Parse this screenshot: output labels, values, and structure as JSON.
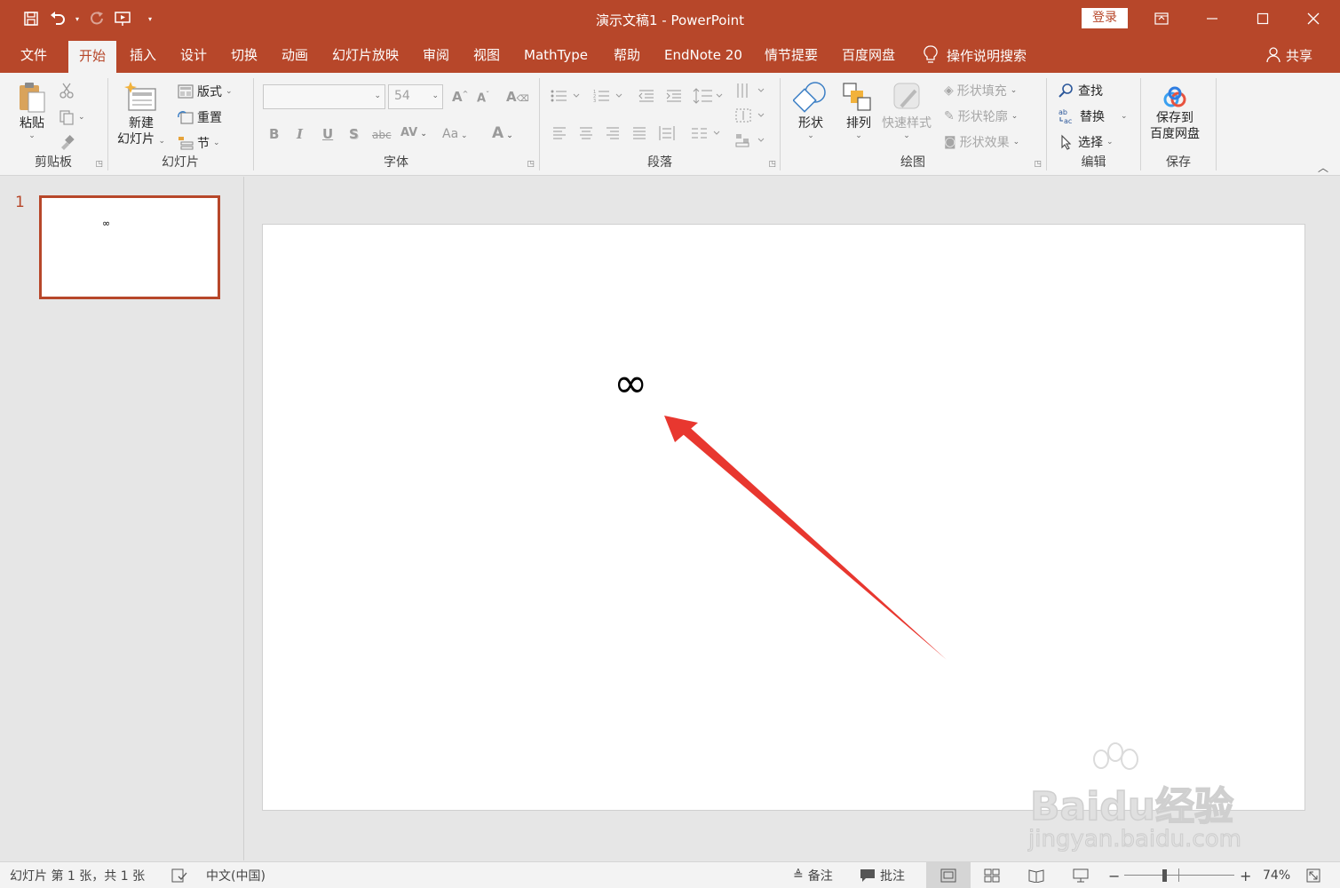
{
  "window": {
    "title": "演示文稿1  -  PowerPoint",
    "login_label": "登录"
  },
  "tabs": [
    "文件",
    "开始",
    "插入",
    "设计",
    "切换",
    "动画",
    "幻灯片放映",
    "审阅",
    "视图",
    "MathType",
    "帮助",
    "EndNote 20",
    "情节提要",
    "百度网盘"
  ],
  "active_tab": "开始",
  "tell_me": "操作说明搜索",
  "share": "共享",
  "ribbon": {
    "clipboard": {
      "paste": "粘贴",
      "group": "剪贴板"
    },
    "slides": {
      "new_slide_line1": "新建",
      "new_slide_line2": "幻灯片",
      "layout": "版式",
      "reset": "重置",
      "section": "节",
      "group": "幻灯片"
    },
    "font": {
      "size": "54",
      "group": "字体"
    },
    "paragraph": {
      "group": "段落"
    },
    "drawing": {
      "shapes": "形状",
      "arrange": "排列",
      "quick_styles": "快速样式",
      "fill": "形状填充",
      "outline": "形状轮廓",
      "effects": "形状效果",
      "group": "绘图"
    },
    "editing": {
      "find": "查找",
      "replace": "替换",
      "select": "选择",
      "group": "编辑"
    },
    "save": {
      "line1": "保存到",
      "line2": "百度网盘",
      "group": "保存"
    }
  },
  "thumbnail": {
    "number": "1",
    "symbol": "∞"
  },
  "slide": {
    "symbol": "∞"
  },
  "watermark": {
    "brand": "Baidu经验",
    "url": "jingyan.baidu.com"
  },
  "status": {
    "slide_info": "幻灯片 第 1 张，共 1 张",
    "language": "中文(中国)",
    "notes": "备注",
    "comments": "批注",
    "zoom": "74%"
  },
  "colors": {
    "accent": "#b7472a",
    "arrow": "#e8372f"
  }
}
